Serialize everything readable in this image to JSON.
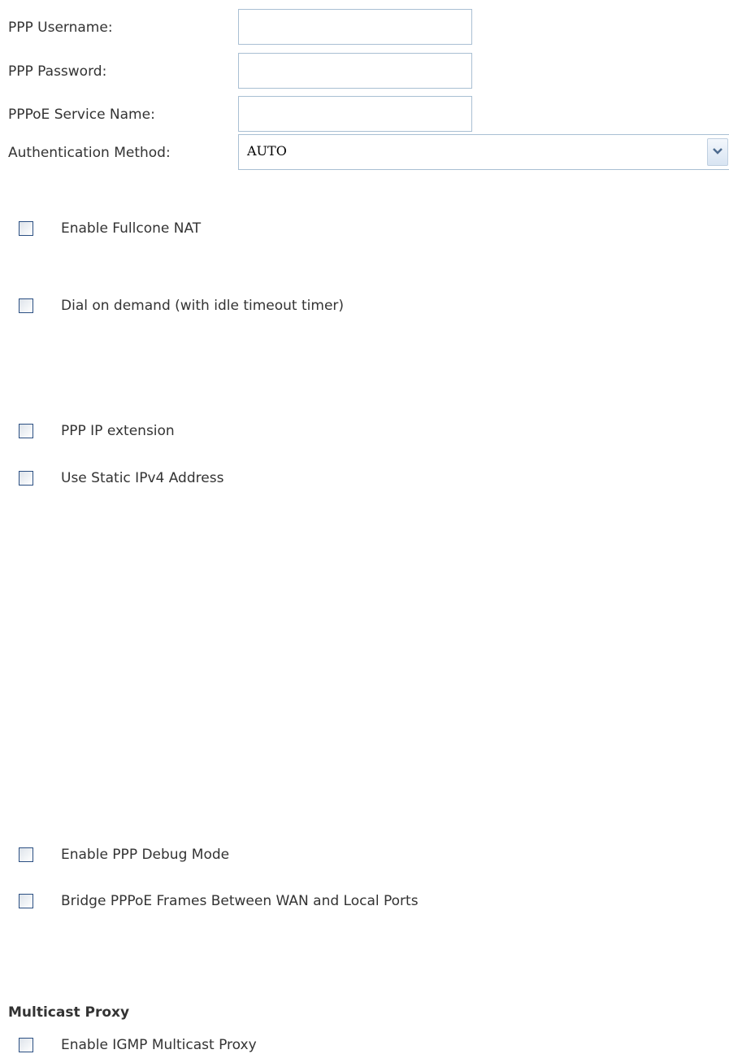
{
  "form": {
    "ppp_username": {
      "label": "PPP Username:",
      "value": ""
    },
    "ppp_password": {
      "label": "PPP Password:",
      "value": ""
    },
    "pppoe_service_name": {
      "label": "PPPoE Service Name:",
      "value": ""
    },
    "auth_method": {
      "label": "Authentication Method:",
      "value": "AUTO"
    }
  },
  "checkboxes": [
    {
      "label": "Enable Fullcone NAT",
      "checked": false
    },
    {
      "label": "Dial on demand (with idle timeout timer)",
      "checked": false
    },
    {
      "label": "PPP IP extension",
      "checked": false
    },
    {
      "label": "Use Static IPv4 Address",
      "checked": false
    },
    {
      "label": "Enable PPP Debug Mode",
      "checked": false
    },
    {
      "label": "Bridge PPPoE Frames Between WAN and Local Ports",
      "checked": false
    }
  ],
  "multicast": {
    "title": "Multicast Proxy",
    "checkbox": {
      "label": "Enable IGMP Multicast Proxy",
      "checked": false
    }
  },
  "colors": {
    "text": "#333333",
    "input_border": "#a9bfd3",
    "checkbox_border": "#2b4f82"
  },
  "icons": {
    "dropdown": "chevron-down-icon"
  }
}
